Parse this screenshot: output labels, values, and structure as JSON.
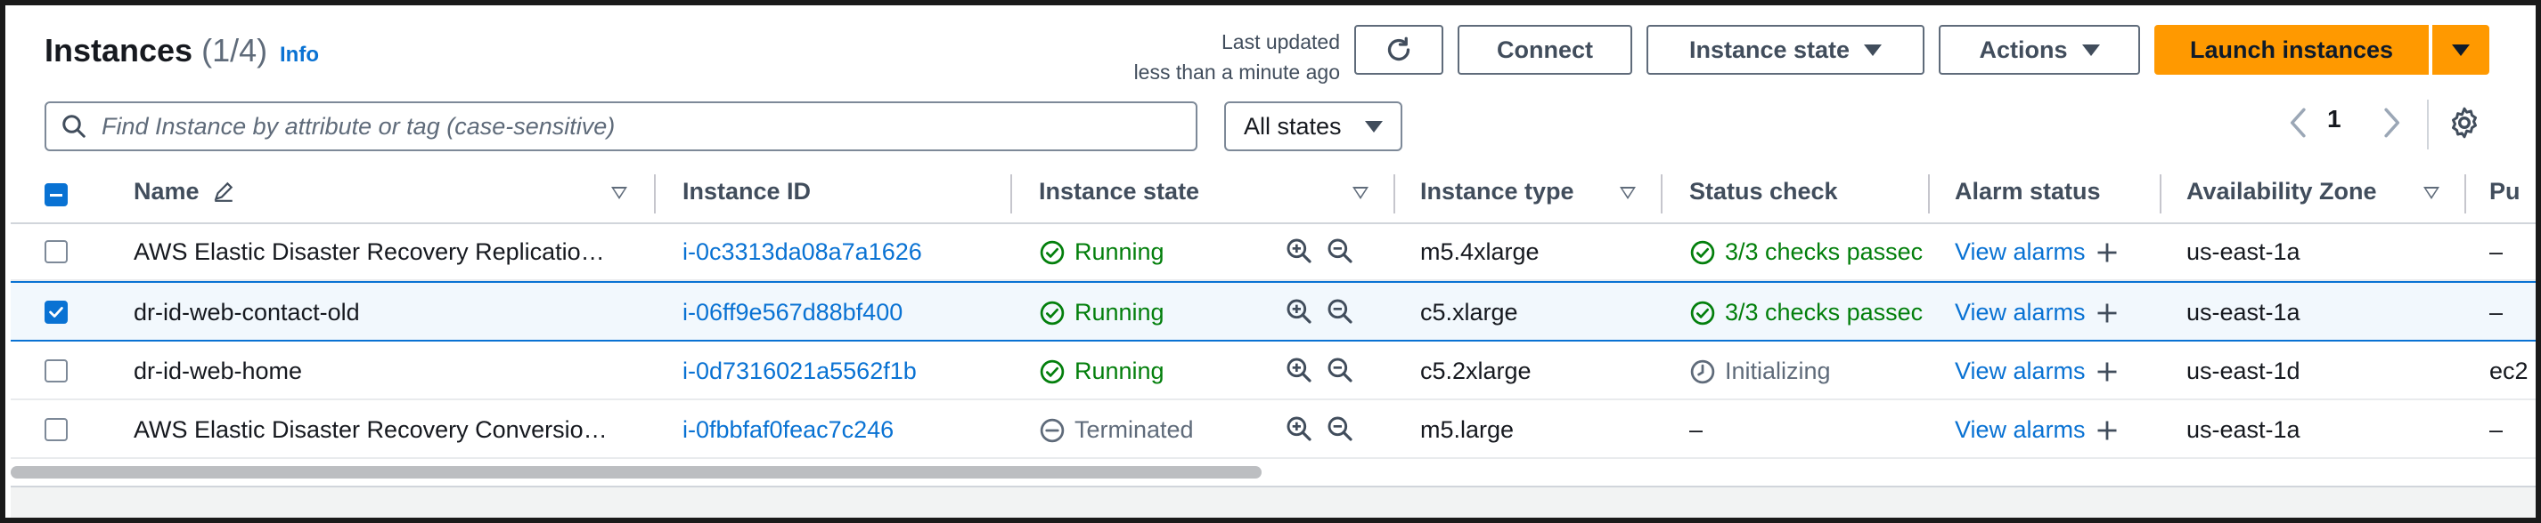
{
  "header": {
    "title": "Instances",
    "count": "(1/4)",
    "info": "Info",
    "last_updated_line1": "Last updated",
    "last_updated_line2": "less than a minute ago",
    "connect_label": "Connect",
    "instance_state_label": "Instance state",
    "actions_label": "Actions",
    "launch_label": "Launch instances"
  },
  "filter": {
    "search_placeholder": "Find Instance by attribute or tag (case-sensitive)",
    "states_selected": "All states",
    "page_number": "1"
  },
  "table": {
    "columns": {
      "name": "Name",
      "instance_id": "Instance ID",
      "instance_state": "Instance state",
      "instance_type": "Instance type",
      "status_check": "Status check",
      "alarm_status": "Alarm status",
      "availability_zone": "Availability Zone",
      "public": "Pu"
    },
    "rows": [
      {
        "name": "AWS Elastic Disaster Recovery Replicatio…",
        "instance_id": "i-0c3313da08a7a1626",
        "state": "Running",
        "type": "m5.4xlarge",
        "status": "3/3 checks passec",
        "alarm": "View alarms",
        "zone": "us-east-1a",
        "public": "–",
        "selected": false
      },
      {
        "name": "dr-id-web-contact-old",
        "instance_id": "i-06ff9e567d88bf400",
        "state": "Running",
        "type": "c5.xlarge",
        "status": "3/3 checks passec",
        "alarm": "View alarms",
        "zone": "us-east-1a",
        "public": "–",
        "selected": true
      },
      {
        "name": "dr-id-web-home",
        "instance_id": "i-0d7316021a5562f1b",
        "state": "Running",
        "type": "c5.2xlarge",
        "status": "Initializing",
        "alarm": "View alarms",
        "zone": "us-east-1d",
        "public": "ec2",
        "selected": false
      },
      {
        "name": "AWS Elastic Disaster Recovery Conversio…",
        "instance_id": "i-0fbbfaf0feac7c246",
        "state": "Terminated",
        "type": "m5.large",
        "status": "–",
        "alarm": "View alarms",
        "zone": "us-east-1a",
        "public": "–",
        "selected": false
      }
    ]
  },
  "colors": {
    "accent": "#0972d3",
    "launch": "#ff9900",
    "running": "#037f0c",
    "muted": "#5f6b7a"
  }
}
